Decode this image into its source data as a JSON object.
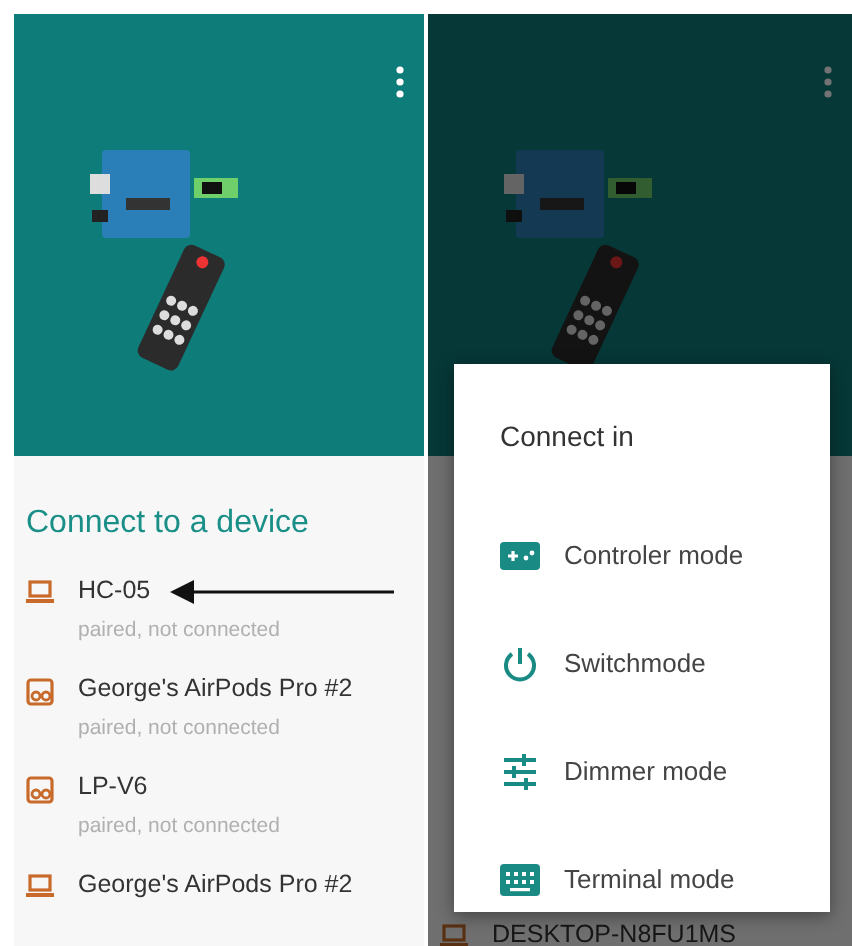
{
  "left_screen": {
    "title": "Connect to a device",
    "devices": [
      {
        "name": "HC-05",
        "status": "paired, not connected",
        "kind": "laptop",
        "pointed_at": true
      },
      {
        "name": "George's AirPods Pro #2",
        "status": "paired, not connected",
        "kind": "headphones",
        "pointed_at": false
      },
      {
        "name": "LP-V6",
        "status": "paired, not connected",
        "kind": "headphones",
        "pointed_at": false
      },
      {
        "name": "George's AirPods Pro #2",
        "kind": "laptop",
        "pointed_at": false
      }
    ]
  },
  "right_screen": {
    "dimmed": true,
    "devices": [
      {
        "name": "DESKTOP-N8FU1MS",
        "kind": "laptop",
        "pointed_at": false
      }
    ],
    "dialog": {
      "title": "Connect in",
      "options": [
        {
          "label": "Controler mode",
          "kind": "controller"
        },
        {
          "label": "Switchmode",
          "kind": "switch"
        },
        {
          "label": "Dimmer mode",
          "kind": "dimmer"
        },
        {
          "label": "Terminal mode",
          "kind": "terminal"
        }
      ]
    }
  }
}
